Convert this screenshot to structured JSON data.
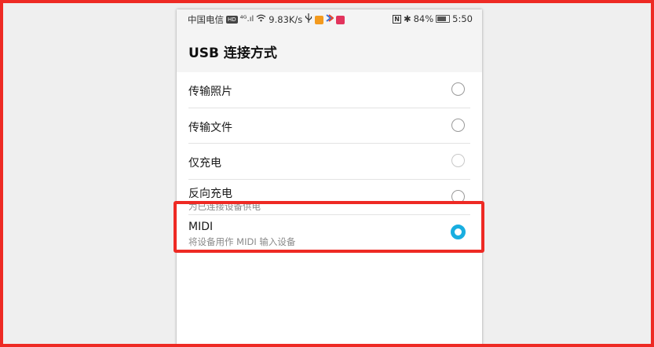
{
  "status_bar": {
    "carrier": "中国电信",
    "hd": "HD",
    "signal": "⁴ᴳ.ıl",
    "speed": "9.83K/s",
    "nfc": "N",
    "bluetooth": "✱",
    "battery_percent": "84%",
    "time": "5:50"
  },
  "header": {
    "title": "USB 连接方式"
  },
  "options": [
    {
      "label": "传输照片",
      "sublabel": "",
      "state": "unselected"
    },
    {
      "label": "传输文件",
      "sublabel": "",
      "state": "unselected"
    },
    {
      "label": "仅充电",
      "sublabel": "",
      "state": "disabled"
    },
    {
      "label": "反向充电",
      "sublabel": "为已连接设备供电",
      "state": "unselected"
    },
    {
      "label": "MIDI",
      "sublabel": "将设备用作 MIDI 输入设备",
      "state": "selected"
    }
  ],
  "colors": {
    "accent": "#19aee0",
    "highlight": "#ee2a24"
  }
}
